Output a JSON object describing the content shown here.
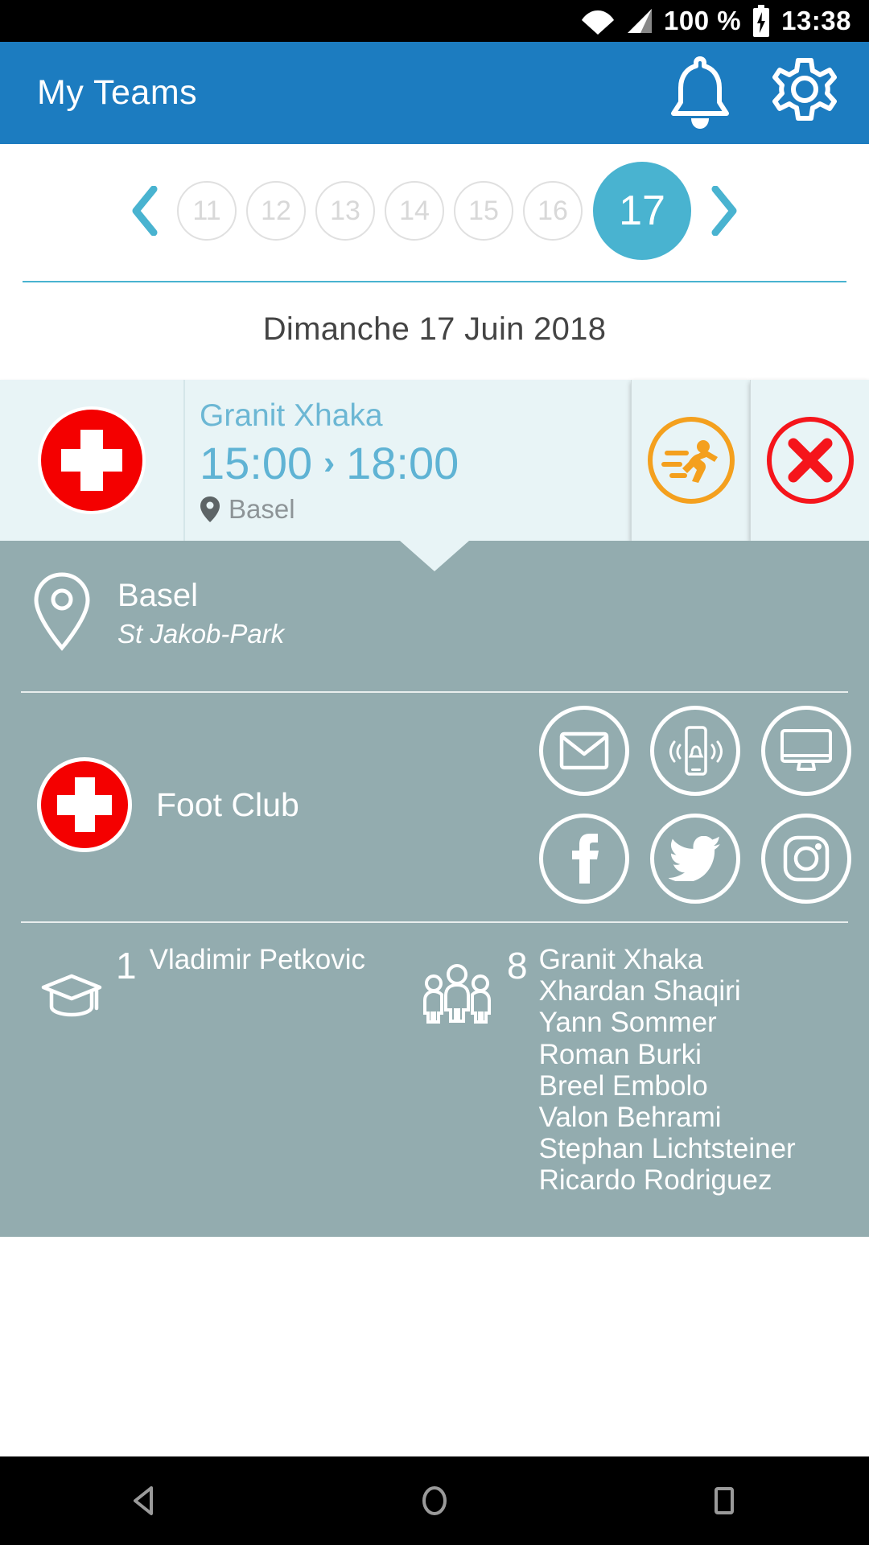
{
  "status_bar": {
    "battery_percent": "100 %",
    "time": "13:38",
    "icons": [
      "wifi-icon",
      "signal-icon",
      "battery-charging-icon"
    ]
  },
  "app_bar": {
    "title": "My Teams",
    "actions": [
      {
        "name": "notifications-bell-icon",
        "label": "Notifications"
      },
      {
        "name": "settings-gear-icon",
        "label": "Settings"
      }
    ],
    "background_color": "#1c7cc0"
  },
  "date_picker": {
    "prev_label": "‹",
    "next_label": "›",
    "days": [
      "11",
      "12",
      "13",
      "14",
      "15",
      "16",
      "17"
    ],
    "selected_day": "17",
    "selected_color": "#49b3d0",
    "full_date": "Dimanche 17 Juin 2018"
  },
  "event": {
    "flag": "swiss-flag-icon",
    "title": "Granit Xhaka",
    "start_time": "15:00",
    "separator": "›",
    "end_time": "18:00",
    "location": "Basel",
    "actions": [
      {
        "name": "attend-running-icon",
        "color": "#f4a01e"
      },
      {
        "name": "decline-close-icon",
        "color": "#f5151b"
      }
    ]
  },
  "detail": {
    "venue": {
      "icon": "map-pin-outline-icon",
      "city": "Basel",
      "stadium": "St Jakob-Park"
    },
    "club": {
      "flag": "swiss-flag-icon",
      "name": "Foot Club",
      "contact_icons": [
        {
          "name": "email-icon"
        },
        {
          "name": "mobile-alert-icon"
        },
        {
          "name": "desktop-monitor-icon"
        }
      ],
      "social_icons": [
        {
          "name": "facebook-icon"
        },
        {
          "name": "twitter-icon"
        },
        {
          "name": "instagram-icon"
        }
      ]
    },
    "coach": {
      "icon": "graduation-cap-icon",
      "count": "1",
      "names": [
        "Vladimir Petkovic"
      ]
    },
    "players": {
      "icon": "people-group-icon",
      "count": "8",
      "names": [
        "Granit Xhaka",
        "Xhardan Shaqiri",
        "Yann Sommer",
        "Roman Burki",
        "Breel Embolo",
        "Valon Behrami",
        "Stephan Lichtsteiner",
        "Ricardo Rodriguez"
      ]
    },
    "background_color": "#93acaf"
  },
  "nav_bar": {
    "buttons": [
      {
        "name": "back-nav-button"
      },
      {
        "name": "home-nav-button"
      },
      {
        "name": "recents-nav-button"
      }
    ]
  }
}
